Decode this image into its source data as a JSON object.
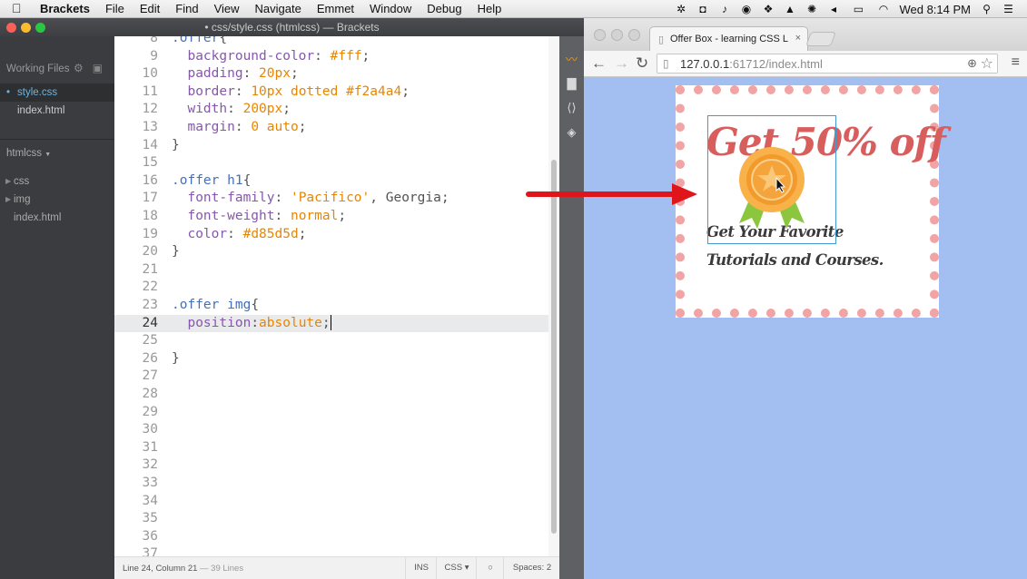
{
  "menubar": {
    "app": "Brackets",
    "menus": [
      "File",
      "Edit",
      "Find",
      "View",
      "Navigate",
      "Emmet",
      "Window",
      "Debug",
      "Help"
    ],
    "clock": "Wed 8:14 PM"
  },
  "brackets": {
    "title": "• css/style.css (htmlcss) — Brackets",
    "working_files_label": "Working Files",
    "working_files": [
      "style.css",
      "index.html"
    ],
    "project_name": "htmlcss",
    "project_tree": [
      "css",
      "img",
      "index.html"
    ],
    "code_lines": [
      {
        "n": "8",
        "html": "<span class='c-sel'>.offer</span><span class='c-punc'>{</span>"
      },
      {
        "n": "9",
        "html": "  <span class='c-prop'>background-color</span>: <span class='c-val'>#fff</span>;"
      },
      {
        "n": "10",
        "html": "  <span class='c-prop'>padding</span>: <span class='c-val'>20px</span>;"
      },
      {
        "n": "11",
        "html": "  <span class='c-prop'>border</span>: <span class='c-val'>10px dotted #f2a4a4</span>;"
      },
      {
        "n": "12",
        "html": "  <span class='c-prop'>width</span>: <span class='c-val'>200px</span>;"
      },
      {
        "n": "13",
        "html": "  <span class='c-prop'>margin</span>: <span class='c-val'>0 auto</span>;"
      },
      {
        "n": "14",
        "html": "}"
      },
      {
        "n": "15",
        "html": ""
      },
      {
        "n": "16",
        "html": "<span class='c-sel'>.offer h1</span>{"
      },
      {
        "n": "17",
        "html": "  <span class='c-prop'>font-family</span>: <span class='c-str'>'Pacifico'</span>, Georgia;"
      },
      {
        "n": "18",
        "html": "  <span class='c-prop'>font-weight</span>: <span class='c-val'>normal</span>;"
      },
      {
        "n": "19",
        "html": "  <span class='c-prop'>color</span>: <span class='c-val'>#d85d5d</span>;"
      },
      {
        "n": "20",
        "html": "}"
      },
      {
        "n": "21",
        "html": ""
      },
      {
        "n": "22",
        "html": ""
      },
      {
        "n": "23",
        "html": "<span class='c-sel'>.offer img</span>{"
      },
      {
        "n": "24",
        "html": "  <span class='c-prop'>position</span>:<span class='c-val'>absolute</span>;<span class='cursor'></span>",
        "current": true
      },
      {
        "n": "25",
        "html": ""
      },
      {
        "n": "26",
        "html": "}"
      },
      {
        "n": "27",
        "html": ""
      },
      {
        "n": "28",
        "html": ""
      },
      {
        "n": "29",
        "html": ""
      },
      {
        "n": "30",
        "html": ""
      },
      {
        "n": "31",
        "html": ""
      },
      {
        "n": "32",
        "html": ""
      },
      {
        "n": "33",
        "html": ""
      },
      {
        "n": "34",
        "html": ""
      },
      {
        "n": "35",
        "html": ""
      },
      {
        "n": "36",
        "html": ""
      },
      {
        "n": "37",
        "html": ""
      }
    ],
    "status": {
      "position": "Line 24, Column 21",
      "lines": "— 39 Lines",
      "ins": "INS",
      "mode": "CSS ▾",
      "spaces": "Spaces: 2"
    }
  },
  "chrome": {
    "tab_title": "Offer Box - learning CSS L",
    "url_host": "127.0.0.1",
    "url_rest": ":61712/index.html",
    "offer": {
      "heading": "Get 50% off",
      "text": "Get Your Favorite Tutorials and Courses."
    }
  }
}
